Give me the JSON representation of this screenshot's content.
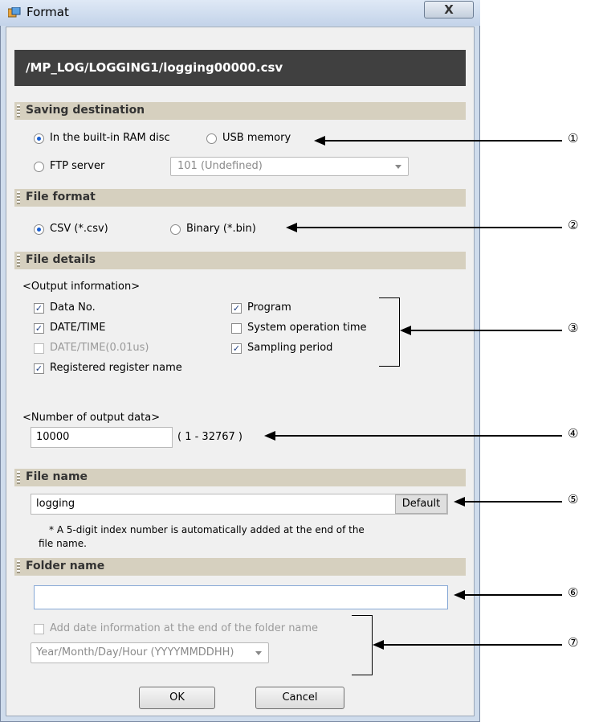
{
  "window": {
    "title": "Format",
    "close_label": "X"
  },
  "path": "/MP_LOG/LOGGING1/logging00000.csv",
  "saving_destination": {
    "header": "Saving destination",
    "ram_label": "In the built-in RAM disc",
    "usb_label": "USB memory",
    "ftp_label": "FTP server",
    "ftp_select_value": "101 (Undefined)"
  },
  "file_format": {
    "header": "File format",
    "csv_label": "CSV (*.csv)",
    "bin_label": "Binary (*.bin)"
  },
  "file_details": {
    "header": "File details",
    "output_info_label": "<Output information>",
    "data_no": "Data No.",
    "date_time": "DATE/TIME",
    "date_time_001": "DATE/TIME(0.01us)",
    "registered_register_name": "Registered register name",
    "program": "Program",
    "system_operation_time": "System operation time",
    "sampling_period": "Sampling period",
    "number_output_label": "<Number of output data>",
    "number_output_value": "10000",
    "number_output_range": "( 1 - 32767 )"
  },
  "file_name": {
    "header": "File name",
    "value": "logging",
    "default_button": "Default",
    "note_line1": "* A 5-digit index number is automatically added at the end of the",
    "note_line2": "file name."
  },
  "folder_name": {
    "header": "Folder name",
    "value": "",
    "add_date_label": "Add date information at the end of the folder name",
    "date_format_value": "Year/Month/Day/Hour (YYYYMMDDHH)"
  },
  "buttons": {
    "ok": "OK",
    "cancel": "Cancel"
  },
  "callouts": [
    "①",
    "②",
    "③",
    "④",
    "⑤",
    "⑥",
    "⑦"
  ]
}
